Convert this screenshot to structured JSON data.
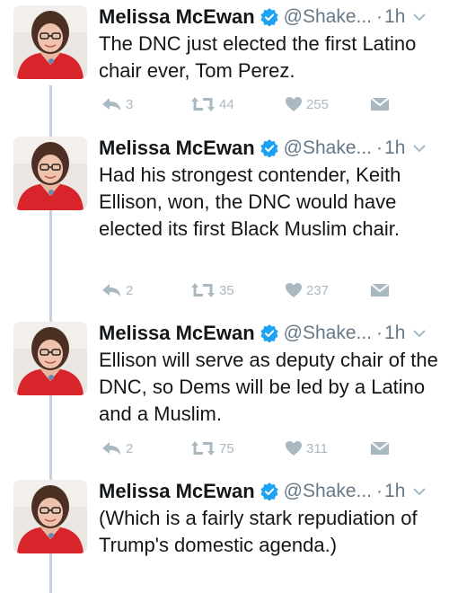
{
  "colors": {
    "text": "#14171a",
    "muted": "#657786",
    "action": "#aab8c2",
    "verified": "#1da1f2",
    "thread_line": "#c4d0da"
  },
  "icons": [
    "reply-icon",
    "retweet-icon",
    "like-icon",
    "dm-icon",
    "verified-badge-icon",
    "chevron-down-icon"
  ],
  "tweets": [
    {
      "name": "Melissa McEwan",
      "handle": "@Shake...",
      "dot": "·",
      "time": "1h",
      "text": "The DNC just elected the first Latino chair ever, Tom Perez.",
      "replies": "3",
      "retweets": "44",
      "likes": "255"
    },
    {
      "name": "Melissa McEwan",
      "handle": "@Shake...",
      "dot": "·",
      "time": "1h",
      "text": "Had his strongest contender, Keith Ellison, won, the DNC would have elected its first Black Muslim chair.",
      "replies": "2",
      "retweets": "35",
      "likes": "237"
    },
    {
      "name": "Melissa McEwan",
      "handle": "@Shake...",
      "dot": "·",
      "time": "1h",
      "text": "Ellison will serve as deputy chair of the DNC, so Dems will be led by a Latino and a Muslim.",
      "replies": "2",
      "retweets": "75",
      "likes": "311"
    },
    {
      "name": "Melissa McEwan",
      "handle": "@Shake...",
      "dot": "·",
      "time": "1h",
      "text": "(Which is a fairly stark repudiation of Trump's domestic agenda.)"
    }
  ]
}
